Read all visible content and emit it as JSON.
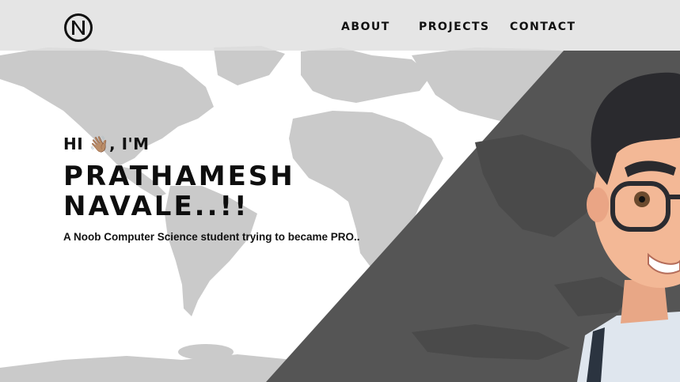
{
  "nav": {
    "logo_letter": "N",
    "links": [
      "ABOUT",
      "PROJECTS",
      "CONTACT"
    ]
  },
  "hero": {
    "greeting": "HI 👋🏽, I'M",
    "name_line1": "PRATHAMESH",
    "name_line2": "NAVALE..!!",
    "tagline": "A Noob Computer Science student trying to became PRO.."
  },
  "colors": {
    "dark_panel": "#555555",
    "map_gray": "#c8c8c8",
    "navbar_bg": "#e1e1e1",
    "text": "#111111"
  },
  "icons": {
    "logo": "n-logo-icon",
    "avatar": "cartoon-avatar"
  }
}
